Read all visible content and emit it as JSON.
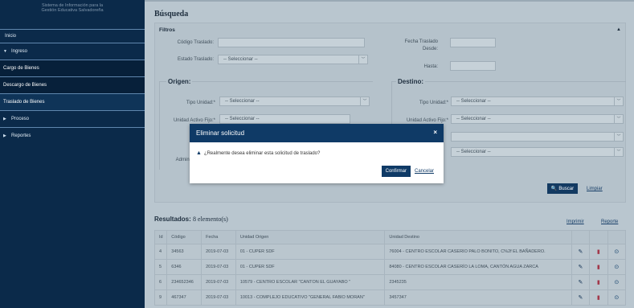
{
  "sidebar": {
    "brand_line1": "Sistema de Información para la",
    "brand_line2": "Gestión Educativa Salvadoreña",
    "items": [
      {
        "label": "Inicio"
      },
      {
        "label": "Ingreso"
      },
      {
        "label": "Cargo de Bienes"
      },
      {
        "label": "Descargo de Bienes"
      },
      {
        "label": "Traslado de Bienes"
      },
      {
        "label": "Proceso"
      },
      {
        "label": "Reportes"
      }
    ]
  },
  "search": {
    "title": "Búsqueda",
    "filters_title": "Filtros",
    "codigo_label": "Código Traslado:",
    "estado_label": "Estado Traslado:",
    "estado_value": "-- Seleccionar --",
    "fecha_label": "Fecha Traslado",
    "desde_label": "Desde:",
    "hasta_label": "Hasta:",
    "origen_title": "Origen:",
    "destino_title": "Destino:",
    "tipo_unidad_label": "Tipo Unidad:*",
    "unidad_activo_label": "Unidad Activo Fijo:*",
    "mu_label": "Mu",
    "admin_label": "Admini",
    "select_placeholder": "-- Seleccionar --",
    "buscar_button": "Buscar",
    "limpiar_link": "Limpiar"
  },
  "results": {
    "title_prefix": "Resultados:",
    "count_text": "8 elemento(s)",
    "imprimir": "Imprimir",
    "reporte": "Reporte",
    "columns": [
      "Id",
      "Código",
      "Fecha",
      "Unidad Origen",
      "Unidad Destino"
    ],
    "rows": [
      {
        "id": "4",
        "codigo": "34563",
        "fecha": "2019-07-03",
        "origen": "01 - CUPER SDF",
        "destino": "76004 - CENTRO ESCOLAR CASERIO PALO BONITO, C%2f EL BAÑADERO."
      },
      {
        "id": "5",
        "codigo": "6346",
        "fecha": "2019-07-03",
        "origen": "01 - CUPER SDF",
        "destino": "84080 - CENTRO ESCOLAR CASERÍO LA LOMA, CANTÓN AGUA ZARCA"
      },
      {
        "id": "6",
        "codigo": "234652346",
        "fecha": "2019-07-03",
        "origen": "10579 - CENTRO ESCOLAR \"CANTON EL GUAYABO \"",
        "destino": "2345235"
      },
      {
        "id": "9",
        "codigo": "467347",
        "fecha": "2019-07-03",
        "origen": "10013 - COMPLEJO EDUCATIVO \"GENERAL FABIO MORAN\"",
        "destino": "3457347"
      }
    ]
  },
  "modal": {
    "title": "Eliminar solicitud",
    "close": "×",
    "message": "¿Realmente desea eliminar esta solicitud de traslado?",
    "confirm": "Confirmar",
    "cancel": "Cancelar"
  }
}
